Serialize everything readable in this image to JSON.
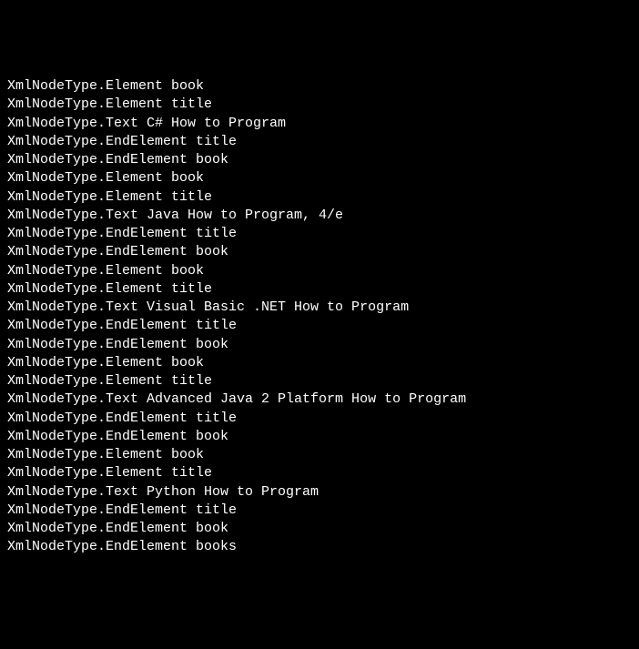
{
  "lines": [
    "XmlNodeType.Element book",
    "XmlNodeType.Element title",
    "XmlNodeType.Text C# How to Program",
    "XmlNodeType.EndElement title",
    "XmlNodeType.EndElement book",
    "XmlNodeType.Element book",
    "XmlNodeType.Element title",
    "XmlNodeType.Text Java How to Program, 4/e",
    "XmlNodeType.EndElement title",
    "XmlNodeType.EndElement book",
    "XmlNodeType.Element book",
    "XmlNodeType.Element title",
    "XmlNodeType.Text Visual Basic .NET How to Program",
    "XmlNodeType.EndElement title",
    "XmlNodeType.EndElement book",
    "XmlNodeType.Element book",
    "XmlNodeType.Element title",
    "XmlNodeType.Text Advanced Java 2 Platform How to Program",
    "XmlNodeType.EndElement title",
    "XmlNodeType.EndElement book",
    "XmlNodeType.Element book",
    "XmlNodeType.Element title",
    "XmlNodeType.Text Python How to Program",
    "XmlNodeType.EndElement title",
    "XmlNodeType.EndElement book",
    "XmlNodeType.EndElement books"
  ]
}
